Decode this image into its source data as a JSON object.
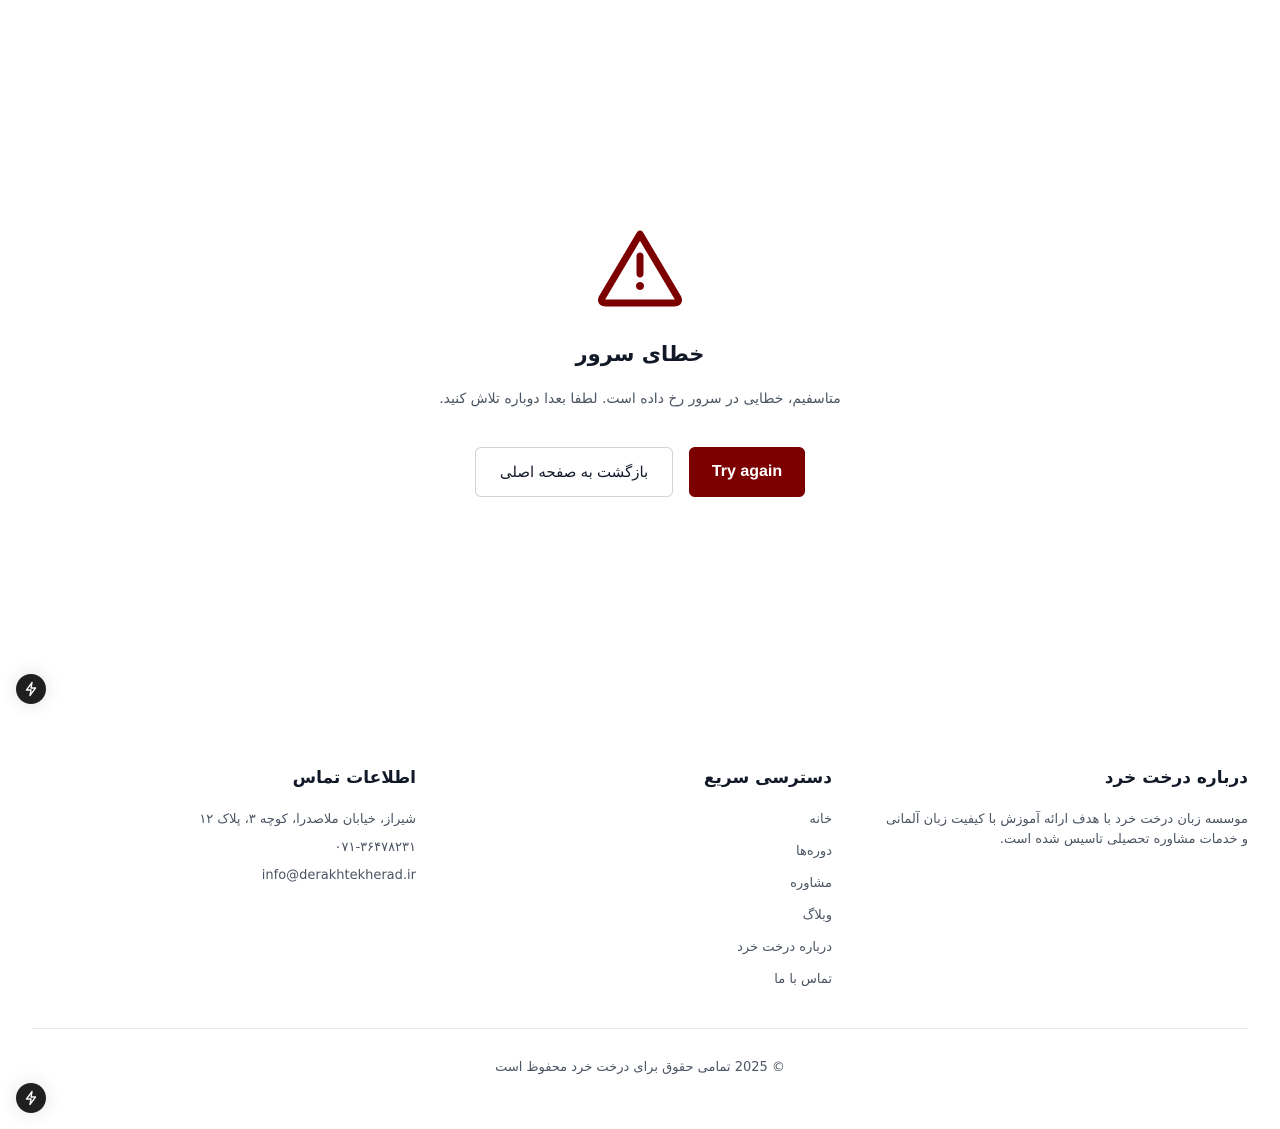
{
  "error": {
    "icon": "warning-triangle-icon",
    "title": "خطای سرور",
    "message": "متاسفیم، خطایی در سرور رخ داده است. لطفا بعدا دوباره تلاش کنید.",
    "try_again_label": "Try again",
    "home_button_label": "بازگشت به صفحه اصلی"
  },
  "footer": {
    "about": {
      "title": "درباره درخت خرد",
      "text": "موسسه زبان درخت خرد با هدف ارائه آموزش با کیفیت زبان آلمانی و خدمات مشاوره تحصیلی تاسیس شده است."
    },
    "quick_links": {
      "title": "دسترسی سریع",
      "items": [
        "خانه",
        "دوره‌ها",
        "مشاوره",
        "وبلاگ",
        "درباره درخت خرد",
        "تماس با ما"
      ]
    },
    "contact": {
      "title": "اطلاعات تماس",
      "address": "شیراز، خیابان ملاصدرا، کوچه ۳، پلاک ۱۲",
      "phone": "۰۷۱-۳۶۴۷۸۲۳۱",
      "email": "info@derakhtekherad.ir"
    },
    "copyright": "© 2025 تمامی حقوق برای درخت خرد محفوظ است"
  },
  "colors": {
    "accent": "#7d0000",
    "text_primary": "#111827",
    "text_secondary": "#4b5563"
  },
  "dev_badge_icon": "lightning-bolt-icon"
}
